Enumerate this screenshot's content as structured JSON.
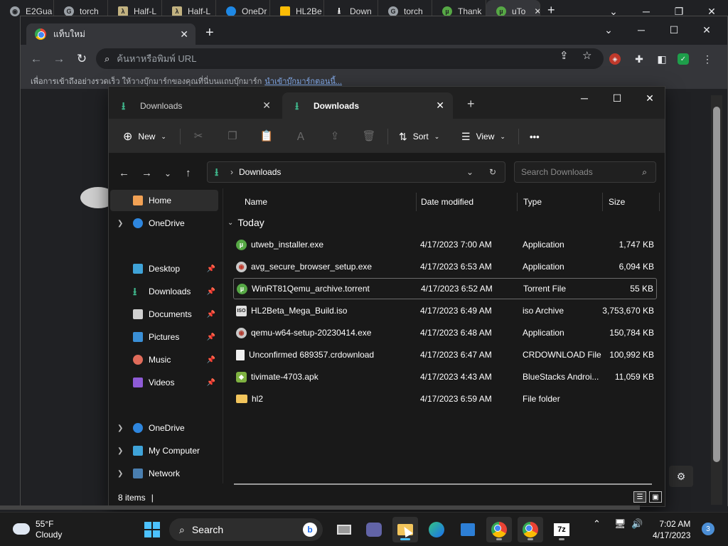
{
  "outer_tabs": [
    "E2Gua",
    "torch",
    "Half-L",
    "Half-L",
    "OneDr",
    "HL2Be",
    "Down",
    "torch",
    "Thank",
    "uTo"
  ],
  "chrome": {
    "tab_title": "แท็บใหม่",
    "omnibox_placeholder": "ค้นหาหรือพิมพ์ URL",
    "bookmark_text": "เพื่อการเข้าถึงอย่างรวดเร็ว ให้วางบุ๊กมาร์กของคุณที่นี่บนแถบบุ๊กมาร์ก",
    "bookmark_link": "นำเข้าบุ๊กมาร์กตอนนี้..."
  },
  "explorer": {
    "tabs": [
      {
        "label": "Downloads"
      },
      {
        "label": "Downloads"
      }
    ],
    "toolbar": {
      "new": "New",
      "sort": "Sort",
      "view": "View",
      "more": "•••"
    },
    "address": "Downloads",
    "search_placeholder": "Search Downloads",
    "sidebar": [
      {
        "label": "Home"
      },
      {
        "label": "OneDrive"
      },
      {
        "label": "Desktop"
      },
      {
        "label": "Downloads"
      },
      {
        "label": "Documents"
      },
      {
        "label": "Pictures"
      },
      {
        "label": "Music"
      },
      {
        "label": "Videos"
      },
      {
        "label": "OneDrive"
      },
      {
        "label": "My Computer"
      },
      {
        "label": "Network"
      }
    ],
    "columns": [
      "Name",
      "Date modified",
      "Type",
      "Size"
    ],
    "group": "Today",
    "files": [
      {
        "name": "utweb_installer.exe",
        "date": "4/17/2023 7:00 AM",
        "type": "Application",
        "size": "1,747 KB"
      },
      {
        "name": "avg_secure_browser_setup.exe",
        "date": "4/17/2023 6:53 AM",
        "type": "Application",
        "size": "6,094 KB"
      },
      {
        "name": "WinRT81Qemu_archive.torrent",
        "date": "4/17/2023 6:52 AM",
        "type": "Torrent File",
        "size": "55 KB"
      },
      {
        "name": "HL2Beta_Mega_Build.iso",
        "date": "4/17/2023 6:49 AM",
        "type": "iso Archive",
        "size": "3,753,670 KB"
      },
      {
        "name": "qemu-w64-setup-20230414.exe",
        "date": "4/17/2023 6:48 AM",
        "type": "Application",
        "size": "150,784 KB"
      },
      {
        "name": "Unconfirmed 689357.crdownload",
        "date": "4/17/2023 6:47 AM",
        "type": "CRDOWNLOAD File",
        "size": "100,992 KB"
      },
      {
        "name": "tivimate-4703.apk",
        "date": "4/17/2023 4:43 AM",
        "type": "BlueStacks Androi...",
        "size": "11,059 KB"
      },
      {
        "name": "hl2",
        "date": "4/17/2023 6:59 AM",
        "type": "File folder",
        "size": ""
      }
    ],
    "status": "8 items"
  },
  "taskbar": {
    "temp": "55°F",
    "condition": "Cloudy",
    "search": "Search",
    "time": "7:02 AM",
    "date": "4/17/2023",
    "notifications": "3"
  }
}
